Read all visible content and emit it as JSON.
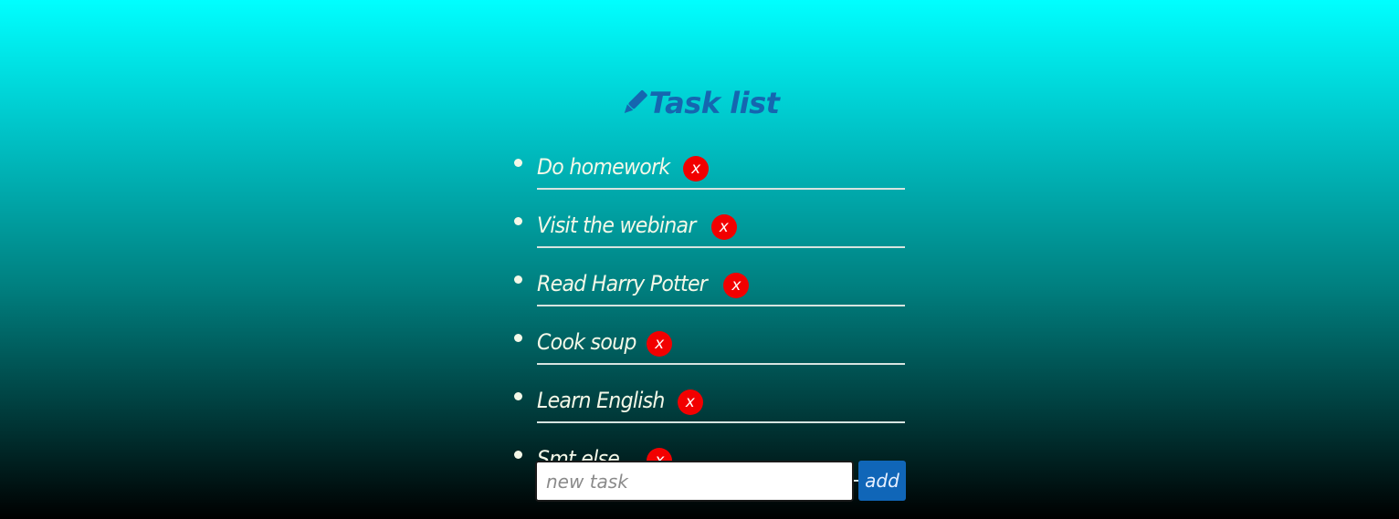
{
  "header": {
    "title": "Task list",
    "icon": "pencil-icon",
    "title_color": "#1566b0"
  },
  "tasks": [
    {
      "label": "Do homework",
      "delete_label": "x"
    },
    {
      "label": "Visit the webinar",
      "delete_label": "x"
    },
    {
      "label": "Read Harry Potter",
      "delete_label": "x"
    },
    {
      "label": "Cook soup",
      "delete_label": "x"
    },
    {
      "label": "Learn English",
      "delete_label": "x"
    },
    {
      "label": "Smt else...",
      "delete_label": "x"
    }
  ],
  "new_task": {
    "value": "",
    "placeholder": "new task",
    "add_label": "add"
  },
  "colors": {
    "delete_button": "#f20000",
    "add_button": "#1066b8",
    "background_top": "#00ffff",
    "background_bottom": "#000000"
  }
}
